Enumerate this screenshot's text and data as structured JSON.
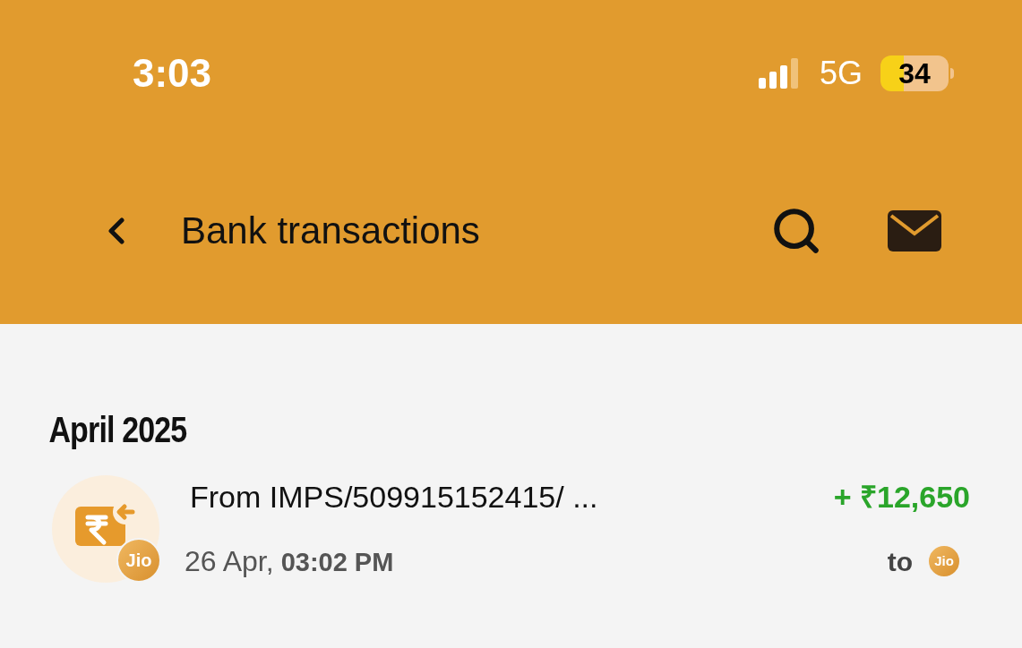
{
  "status_bar": {
    "time": "3:03",
    "network": "5G",
    "battery": "34"
  },
  "header": {
    "title": "Bank transactions"
  },
  "sections": [
    {
      "title": "April 2025",
      "transactions": [
        {
          "kind": "credit",
          "description": "From IMPS/509915152415/ ...",
          "badge": "Jio",
          "date": "26 Apr,",
          "time": "03:02 PM",
          "amount": "+ ₹12,650",
          "to_label": "to",
          "to_badge": "Jio"
        }
      ]
    }
  ]
}
